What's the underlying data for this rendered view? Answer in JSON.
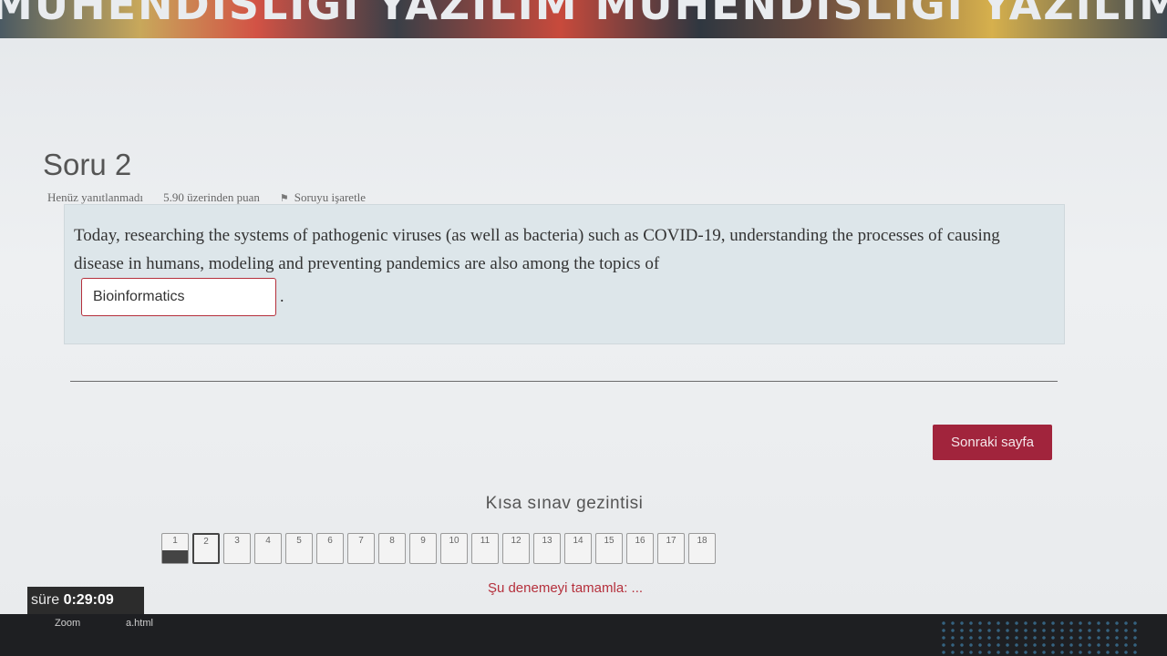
{
  "banner": {
    "text": "MÜHENDİSLİĞİ YAZILIM MÜHENDİSLİĞİ YAZILIM MÜHENDİSLİĞİ"
  },
  "question": {
    "title": "Soru 2",
    "status": "Henüz yanıtlanmadı",
    "points": "5.90 üzerinden puan",
    "flag_label": "Soruyu işaretle",
    "text": "Today, researching the systems of pathogenic viruses (as well as bacteria) such as COVID-19, understanding the processes of causing disease in humans, modeling and preventing pandemics are also among the topics of",
    "answer_value": "Bioinformatics",
    "period": "."
  },
  "next_button_label": "Sonraki sayfa",
  "navigation": {
    "title": "Kısa sınav gezintisi",
    "buttons": [
      "1",
      "2",
      "3",
      "4",
      "5",
      "6",
      "7",
      "8",
      "9",
      "10",
      "11",
      "12",
      "13",
      "14",
      "15",
      "16",
      "17",
      "18"
    ],
    "answered": [
      "1"
    ],
    "current": "2",
    "finish_link": "Şu denemeyi tamamla: ..."
  },
  "timer": {
    "label": "süre",
    "value": "0:29:09"
  },
  "taskbar": {
    "items": [
      "Zoom",
      "a.html"
    ]
  },
  "colors": {
    "accent": "#a1243c",
    "link": "#b5303c",
    "box": "#dde6ea"
  }
}
